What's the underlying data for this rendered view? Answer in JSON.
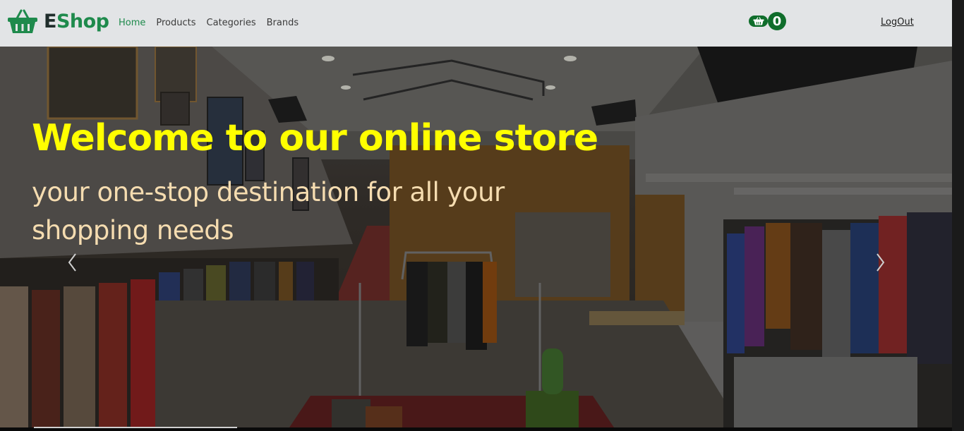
{
  "navbar": {
    "brand_e": "E",
    "brand_rest": "Shop",
    "links": [
      {
        "label": "Home",
        "active": true
      },
      {
        "label": "Products",
        "active": false
      },
      {
        "label": "Categories",
        "active": false
      },
      {
        "label": "Brands",
        "active": false
      }
    ],
    "cart_count": "0",
    "logout_label": "LogOut",
    "icons": {
      "brand": "shopping-basket-icon",
      "cart": "shopping-basket-icon"
    }
  },
  "hero": {
    "title": "Welcome to our online store",
    "subtitle": "your one-stop destination for all your shopping needs",
    "icons": {
      "prev": "chevron-left-icon",
      "next": "chevron-right-icon"
    }
  },
  "colors": {
    "brand_green": "#1e8a4c",
    "cart_green": "#0f6d2b",
    "title_yellow": "#ffff00",
    "subtitle_beige": "#f5dcb0",
    "navbar_bg": "#e2e4e6"
  }
}
